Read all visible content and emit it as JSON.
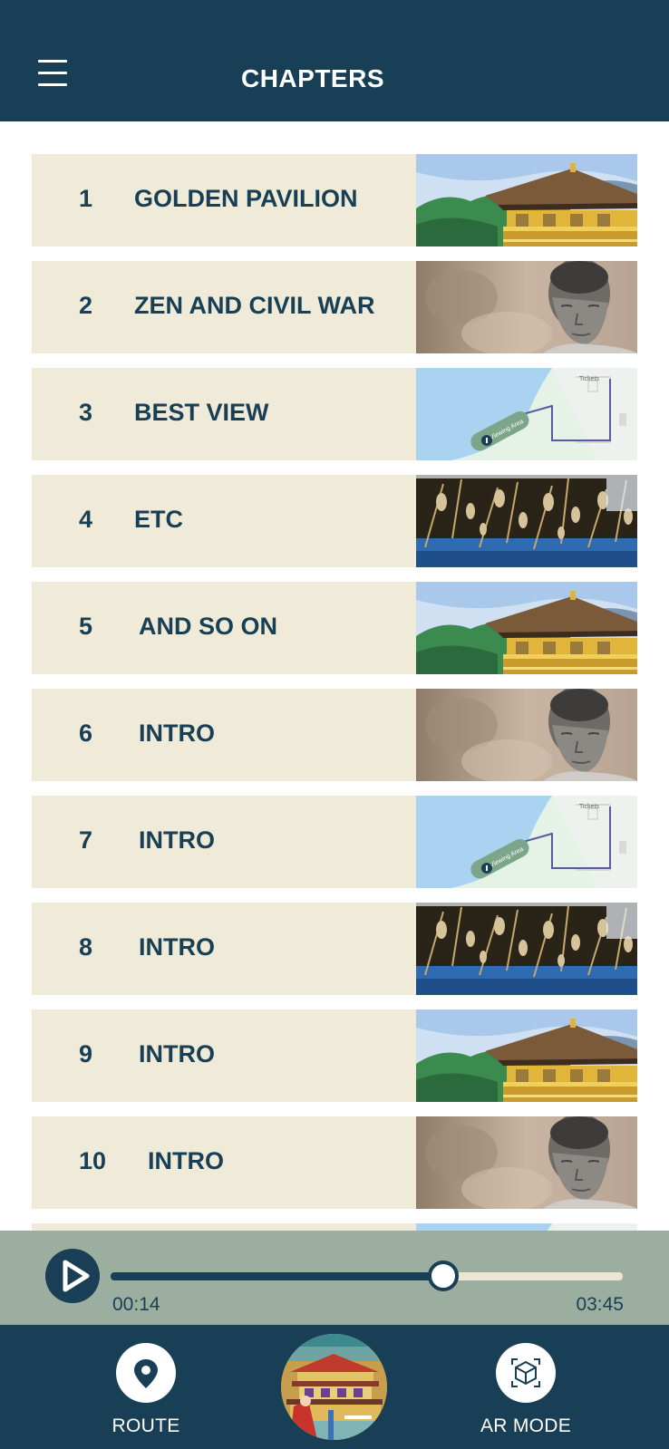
{
  "header": {
    "title": "CHAPTERS",
    "menu_icon": "hamburger-menu-icon"
  },
  "chapters": [
    {
      "num": "1",
      "title": "GOLDEN PAVILION",
      "thumb": "pavilion"
    },
    {
      "num": "2",
      "title": "ZEN AND CIVIL WAR",
      "thumb": "buddha"
    },
    {
      "num": "3",
      "title": "BEST VIEW",
      "thumb": "map"
    },
    {
      "num": "4",
      "title": "ETC",
      "thumb": "reeds"
    },
    {
      "num": "5",
      "title": "AND SO ON",
      "thumb": "pavilion"
    },
    {
      "num": "6",
      "title": "INTRO",
      "thumb": "buddha"
    },
    {
      "num": "7",
      "title": "INTRO",
      "thumb": "map"
    },
    {
      "num": "8",
      "title": "INTRO",
      "thumb": "reeds"
    },
    {
      "num": "9",
      "title": "INTRO",
      "thumb": "pavilion"
    },
    {
      "num": "10",
      "title": "INTRO",
      "thumb": "buddha"
    },
    {
      "num": "",
      "title": "",
      "thumb": "map"
    }
  ],
  "map_labels": {
    "tickets": "Tickets",
    "area": "Viewing Area"
  },
  "player": {
    "current_time": "00:14",
    "total_time": "03:45",
    "progress": 0.65,
    "play_icon": "play-icon"
  },
  "bottom_nav": {
    "route_label": "ROUTE",
    "route_icon": "map-pin-icon",
    "ar_label": "AR MODE",
    "ar_icon": "ar-cube-icon"
  },
  "colors": {
    "primary": "#183f55",
    "row_bg": "#f0ebd8",
    "player_bg": "#9cae9f",
    "track_bg": "#ece6d2"
  }
}
